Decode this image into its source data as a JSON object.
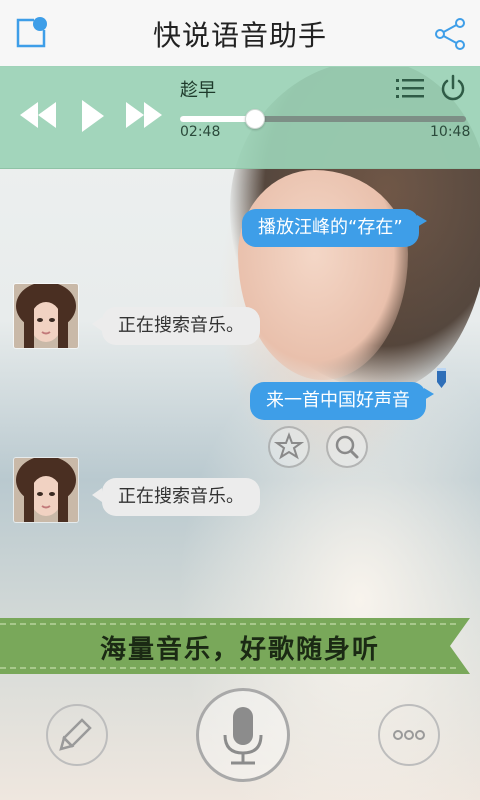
{
  "header": {
    "title": "快说语音助手"
  },
  "player": {
    "song_title": "趁早",
    "current_time": "02:48",
    "total_time": "10:48",
    "progress": 0.26
  },
  "chat": {
    "messages": [
      {
        "role": "user",
        "text": "播放汪峰的“存在”"
      },
      {
        "role": "bot",
        "text": "正在搜索音乐。"
      },
      {
        "role": "user",
        "text": "来一首中国好声音"
      },
      {
        "role": "bot",
        "text": "正在搜索音乐。"
      }
    ]
  },
  "banner": {
    "text": "海量音乐，好歌随身听"
  },
  "colors": {
    "accent_blue": "#3e9ee8",
    "player_green": "#9bd2b6",
    "banner_green": "#79a85a"
  },
  "icons": {
    "message": "message-icon",
    "share": "share-icon",
    "prev": "previous-icon",
    "play": "play-icon",
    "next": "next-icon",
    "playlist": "playlist-icon",
    "power": "power-icon",
    "pen": "pen-icon",
    "mic": "microphone-icon",
    "more": "more-icon",
    "star": "star-icon",
    "search": "search-icon"
  }
}
